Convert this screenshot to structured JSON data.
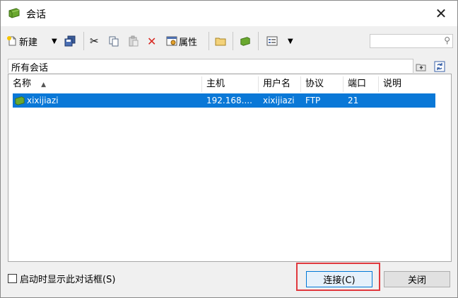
{
  "window": {
    "title": "会话",
    "close_glyph": "✕",
    "app_icon": "green-folder-icon"
  },
  "toolbar": {
    "new_label": "新建",
    "properties_label": "属性",
    "dropdown_glyph": "▼",
    "cut_glyph": "✂",
    "delete_glyph": "✕",
    "search_value": "",
    "search_icon": "search-icon"
  },
  "section": {
    "label": "所有会话"
  },
  "table": {
    "columns": [
      "名称",
      "主机",
      "用户名",
      "协议",
      "端口",
      "说明"
    ],
    "sort_glyph": "▲",
    "rows": [
      {
        "name": "xixijiazi",
        "host": "192.168....",
        "user": "xixijiazi",
        "protocol": "FTP",
        "port": "21",
        "note": ""
      }
    ]
  },
  "footer": {
    "checkbox_label": "启动时显示此对话框(S)",
    "connect_label": "连接(C)",
    "close_label": "关闭"
  },
  "colors": {
    "selection": "#0a78d7",
    "highlight": "#e0393e",
    "accent_green": "#6aa82f"
  }
}
